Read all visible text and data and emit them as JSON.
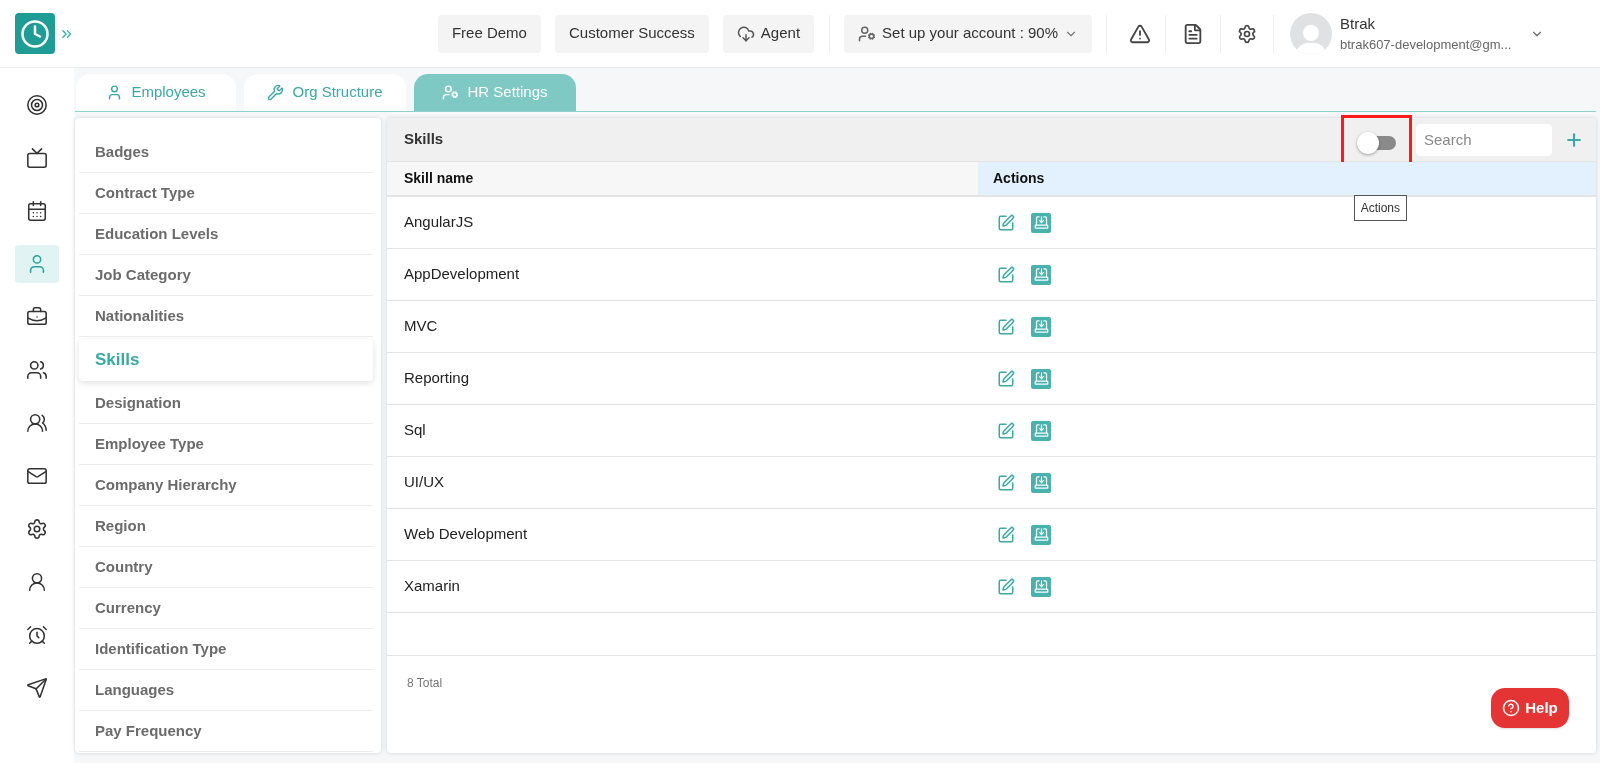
{
  "header": {
    "buttons": [
      {
        "label": "Free Demo",
        "kind": "plain"
      },
      {
        "label": "Customer Success",
        "kind": "plain"
      },
      {
        "label": "Agent",
        "kind": "cloud"
      }
    ],
    "setup": {
      "label": "Set up your account : 90%"
    },
    "user": {
      "name": "Btrak",
      "email": "btrak607-development@gm..."
    }
  },
  "nav_rail": [
    {
      "selected": false
    },
    {
      "selected": false
    },
    {
      "selected": false
    },
    {
      "selected": true
    },
    {
      "selected": false
    },
    {
      "selected": false
    },
    {
      "selected": false
    },
    {
      "selected": false
    },
    {
      "selected": false
    },
    {
      "selected": false
    },
    {
      "selected": false
    },
    {
      "selected": false
    }
  ],
  "tabs": [
    {
      "label": "Employees",
      "selected": false
    },
    {
      "label": "Org Structure",
      "selected": false
    },
    {
      "label": "HR Settings",
      "selected": true
    }
  ],
  "settings_menu": [
    {
      "label": "Badges",
      "selected": false
    },
    {
      "label": "Contract Type",
      "selected": false
    },
    {
      "label": "Education Levels",
      "selected": false
    },
    {
      "label": "Job Category",
      "selected": false
    },
    {
      "label": "Nationalities",
      "selected": false
    },
    {
      "label": "Skills",
      "selected": true
    },
    {
      "label": "Designation",
      "selected": false
    },
    {
      "label": "Employee Type",
      "selected": false
    },
    {
      "label": "Company Hierarchy",
      "selected": false
    },
    {
      "label": "Region",
      "selected": false
    },
    {
      "label": "Country",
      "selected": false
    },
    {
      "label": "Currency",
      "selected": false
    },
    {
      "label": "Identification Type",
      "selected": false
    },
    {
      "label": "Languages",
      "selected": false
    },
    {
      "label": "Pay Frequency",
      "selected": false
    }
  ],
  "panel": {
    "title": "Skills",
    "toggle": {
      "on": false,
      "highlighted": true
    },
    "search": {
      "placeholder": "Search"
    },
    "tooltip": "Actions",
    "table": {
      "columns": [
        "Skill name",
        "Actions"
      ],
      "rows": [
        {
          "name": "AngularJS"
        },
        {
          "name": "AppDevelopment"
        },
        {
          "name": "MVC"
        },
        {
          "name": "Reporting"
        },
        {
          "name": "Sql"
        },
        {
          "name": "UI/UX"
        },
        {
          "name": "Web Development"
        },
        {
          "name": "Xamarin"
        }
      ]
    },
    "footer": "8 Total"
  },
  "help": {
    "label": "Help"
  }
}
